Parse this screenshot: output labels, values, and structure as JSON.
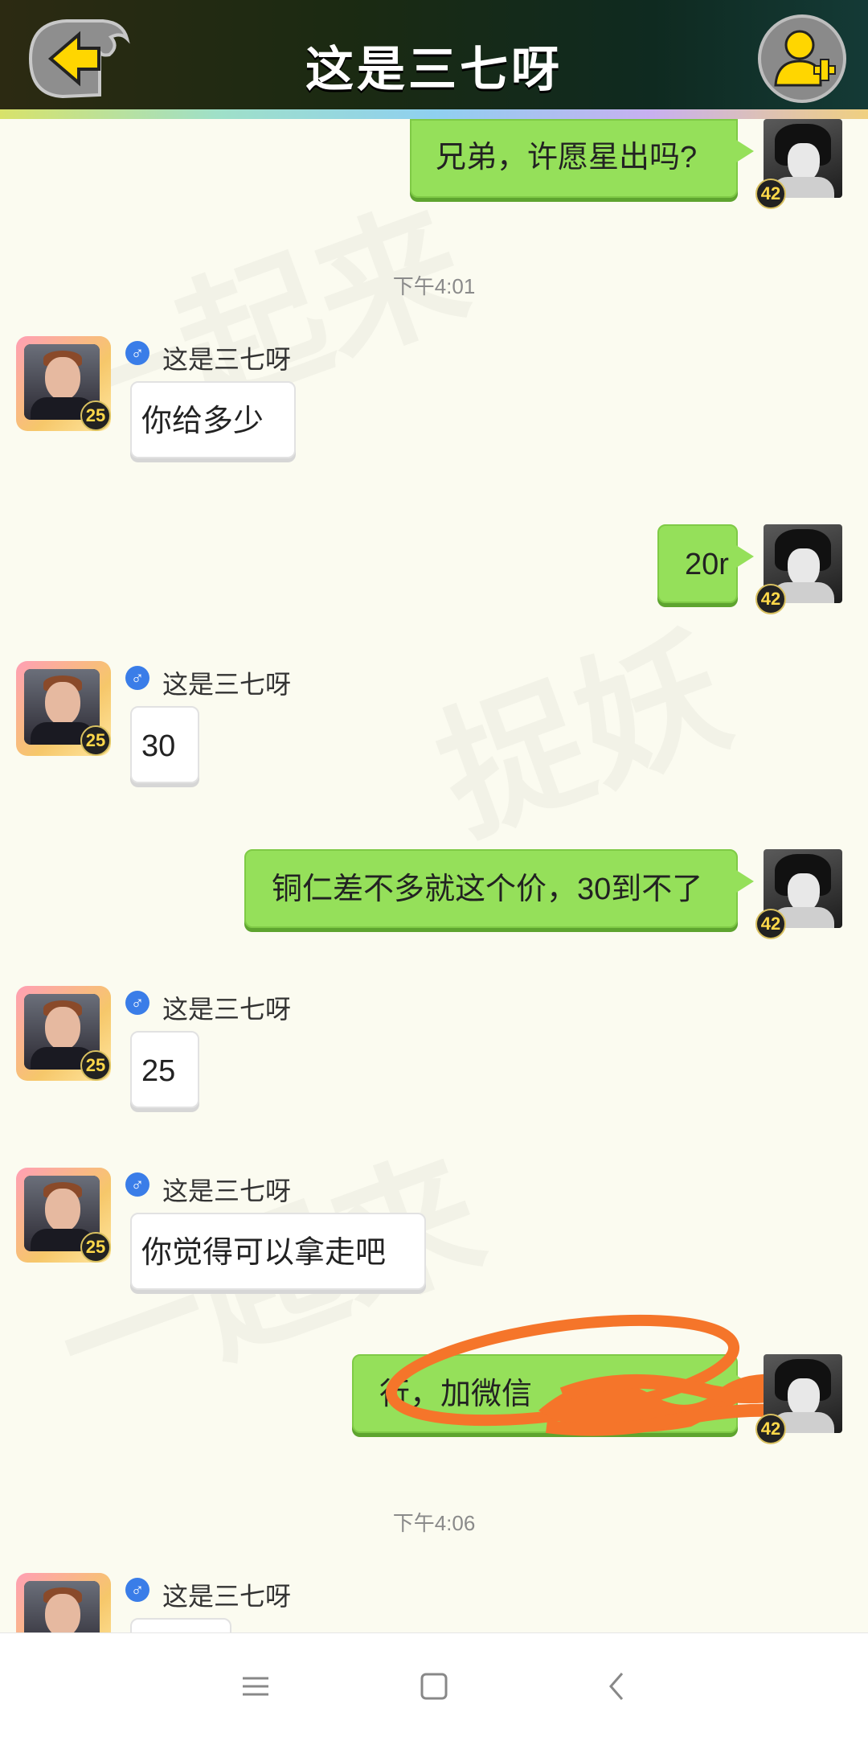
{
  "header": {
    "title": "这是三七呀",
    "back_icon": "arrow-left-icon",
    "add_friend_icon": "add-user-icon",
    "accent_color": "#ffd600"
  },
  "contact": {
    "name": "这是三七呀",
    "gender_symbol": "♂",
    "level": "25"
  },
  "self": {
    "level": "42"
  },
  "messages": [
    {
      "sender": "self",
      "text": "兄弟，许愿星出吗?"
    },
    {
      "type": "time",
      "text": "下午4:01"
    },
    {
      "sender": "other",
      "text": "你给多少"
    },
    {
      "sender": "self",
      "text": "20r"
    },
    {
      "sender": "other",
      "text": "30"
    },
    {
      "sender": "self",
      "text": "铜仁差不多就这个价，30到不了"
    },
    {
      "sender": "other",
      "text": "25"
    },
    {
      "sender": "other",
      "text": "你觉得可以拿走吧"
    },
    {
      "sender": "self",
      "text": "行，加微信"
    },
    {
      "type": "time",
      "text": "下午4:06"
    },
    {
      "sender": "other",
      "text": ""
    }
  ],
  "colors": {
    "self_bubble": "#95e05a",
    "other_bubble": "#ffffff",
    "scribble": "#f5752a"
  },
  "nav": {
    "menu_icon": "menu-icon",
    "home_icon": "home-square-icon",
    "back_icon": "chevron-left-icon"
  }
}
